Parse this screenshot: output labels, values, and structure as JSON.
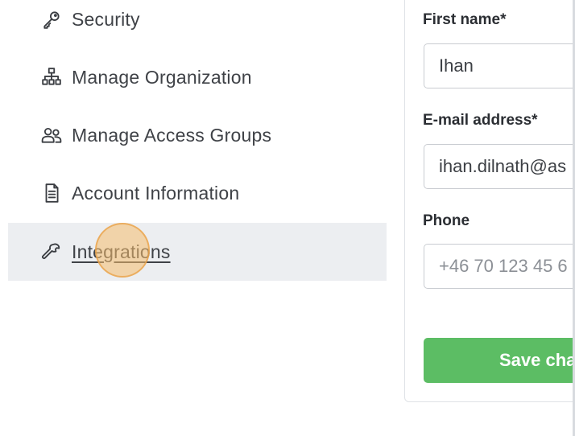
{
  "sidebar": {
    "items": [
      {
        "label": "Security",
        "icon": "key-icon"
      },
      {
        "label": "Manage Organization",
        "icon": "org-chart-icon"
      },
      {
        "label": "Manage Access Groups",
        "icon": "users-icon"
      },
      {
        "label": "Account Information",
        "icon": "document-icon"
      },
      {
        "label": "Integrations",
        "icon": "wrench-icon",
        "active": true
      }
    ]
  },
  "form": {
    "first_name": {
      "label": "First name*",
      "value": "Ihan"
    },
    "email": {
      "label": "E-mail address*",
      "value": "ihan.dilnath@as"
    },
    "phone": {
      "label": "Phone",
      "placeholder": "+46 70 123 45 6"
    },
    "save_label": "Save cha"
  },
  "colors": {
    "active_row": "#eceef1",
    "save_button": "#5cbd64",
    "click_indicator": "#f5be6e"
  }
}
